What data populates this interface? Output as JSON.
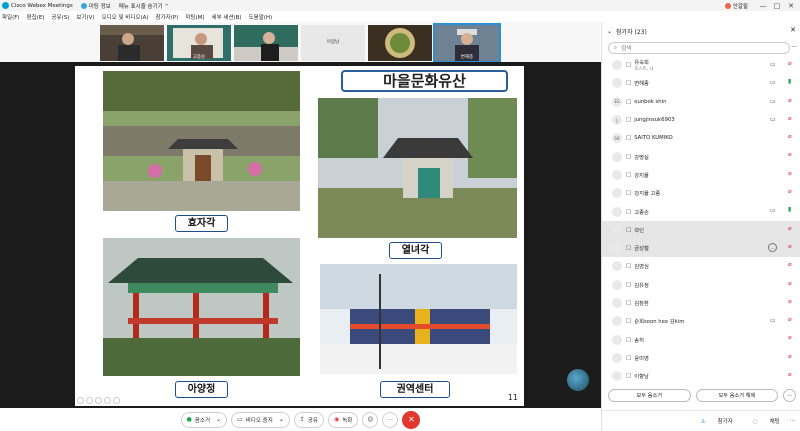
{
  "titlebar": {
    "app_title": "Cisco Webex Meetings",
    "meeting_info": "미팅 정보",
    "menu_toggle": "메뉴 표시줄 숨기기 ⌃",
    "user": "안갈필",
    "win_min": "—",
    "win_max": "□",
    "win_close": "✕"
  },
  "menubar": {
    "items": [
      "파일(F)",
      "편집(E)",
      "공유(S)",
      "보기(V)",
      "오디오 및 비디오(A)",
      "참가자(P)",
      "미팅(M)",
      "세부 세션(B)",
      "도움말(H)"
    ]
  },
  "video_strip": {
    "thumbs": [
      {
        "name": ""
      },
      {
        "name": "고종순"
      },
      {
        "name": ""
      },
      {
        "name": "이양남"
      },
      {
        "name": ""
      },
      {
        "name": "변해종"
      }
    ]
  },
  "slide": {
    "heading": "마을문화유산",
    "labels": [
      "효자각",
      "열녀각",
      "아양정",
      "권역센터"
    ],
    "page": "11"
  },
  "controls": {
    "mute": "음소거",
    "video": "비디오 중지",
    "share": "공유",
    "record": "녹화",
    "more": "···",
    "end": "✕"
  },
  "panel": {
    "title": "참가자 (23)",
    "search_placeholder": "검색",
    "more": "···",
    "participants": [
      {
        "name": "유숙희",
        "sub": "호스트, 나",
        "avatar": "",
        "cam": true,
        "mic": "off",
        "device": "□"
      },
      {
        "name": "변해종",
        "sub": "",
        "avatar": "",
        "cam": true,
        "mic": "on",
        "device": "□"
      },
      {
        "name": "eunbok shin",
        "sub": "",
        "avatar": "ES",
        "cam": true,
        "mic": "off",
        "device": "□"
      },
      {
        "name": "jungjinsuk6903",
        "sub": "",
        "avatar": "J",
        "cam": true,
        "mic": "off",
        "device": "□"
      },
      {
        "name": "SAITO KUMIKO",
        "sub": "",
        "avatar": "SK",
        "cam": false,
        "mic": "off",
        "device": "□"
      },
      {
        "name": "강명실",
        "sub": "",
        "avatar": "",
        "cam": false,
        "mic": "off",
        "device": "□"
      },
      {
        "name": "강지율",
        "sub": "",
        "avatar": "",
        "cam": false,
        "mic": "off",
        "device": "□"
      },
      {
        "name": "강지율 고종",
        "sub": "",
        "avatar": "",
        "cam": false,
        "mic": "off",
        "device": "□"
      },
      {
        "name": "고종순",
        "sub": "",
        "avatar": "",
        "cam": true,
        "mic": "on",
        "device": "□"
      },
      {
        "name": "곽인",
        "sub": "",
        "avatar": "",
        "cam": false,
        "mic": "off",
        "device": "□",
        "highlight": true
      },
      {
        "name": "금성철",
        "sub": "",
        "avatar": "",
        "cam": false,
        "mic": "off",
        "device": "□",
        "highlight": true,
        "chat": true
      },
      {
        "name": "김영심",
        "sub": "",
        "avatar": "",
        "cam": false,
        "mic": "off",
        "device": "□"
      },
      {
        "name": "김유정",
        "sub": "",
        "avatar": "",
        "cam": false,
        "mic": "off",
        "device": "□"
      },
      {
        "name": "김창환",
        "sub": "",
        "avatar": "",
        "cam": false,
        "mic": "off",
        "device": "□"
      },
      {
        "name": "순희soon hee 김kim",
        "sub": "",
        "avatar": "",
        "cam": true,
        "mic": "off",
        "device": "□"
      },
      {
        "name": "송히",
        "sub": "",
        "avatar": "",
        "cam": false,
        "mic": "off",
        "device": "□"
      },
      {
        "name": "윤미영",
        "sub": "",
        "avatar": "",
        "cam": false,
        "mic": "off",
        "device": "□"
      },
      {
        "name": "이향남",
        "sub": "",
        "avatar": "",
        "cam": false,
        "mic": "off",
        "device": "□"
      }
    ],
    "mute_all": "모두 음소거",
    "unmute_all": "모두 음소거 해제",
    "btn_more": "···",
    "footer_participants": "참가자",
    "footer_chat": "채팅",
    "footer_more": "···"
  }
}
